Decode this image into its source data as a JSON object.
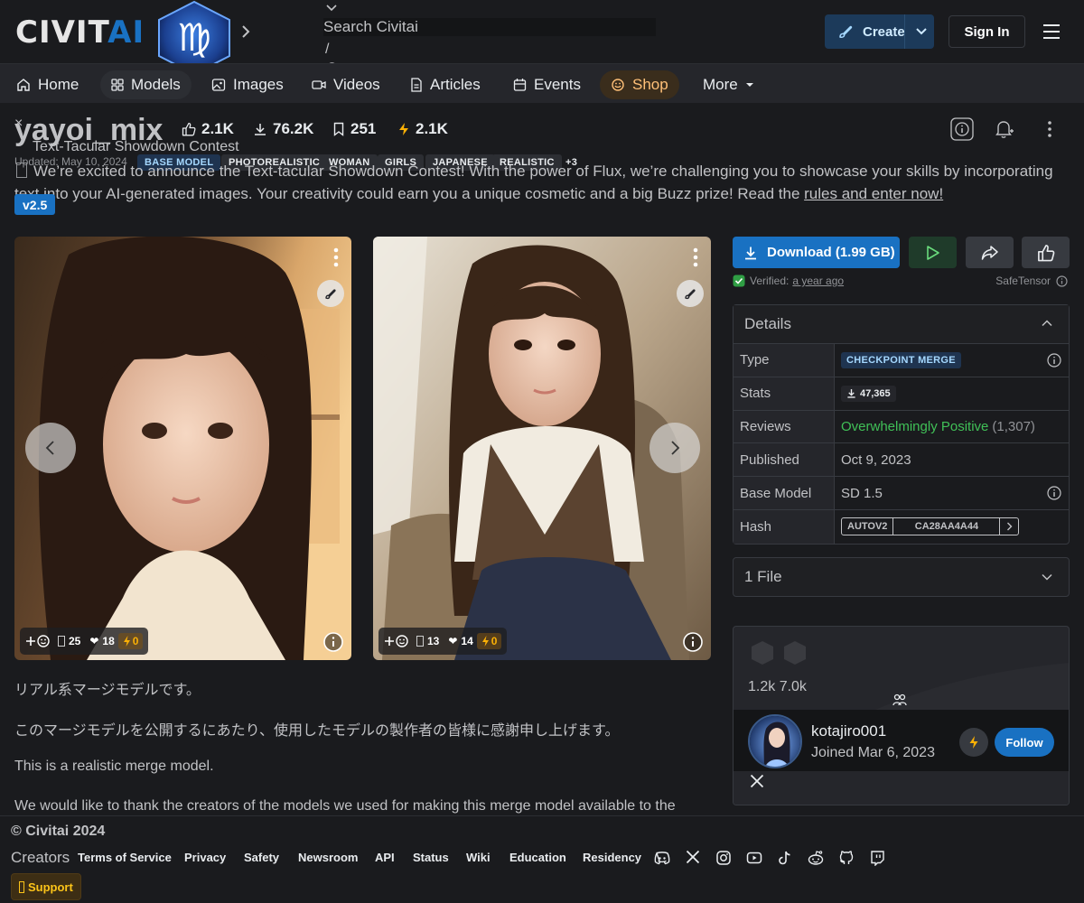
{
  "brand": {
    "logo_part1": "CIVIT",
    "logo_part2": "AI"
  },
  "search": {
    "placeholder": "Search Civitai",
    "shortcut": "/"
  },
  "header": {
    "create_label": "Create",
    "signin_label": "Sign In"
  },
  "nav": [
    {
      "label": "Home",
      "icon": "home-icon"
    },
    {
      "label": "Models",
      "icon": "models-icon"
    },
    {
      "label": "Images",
      "icon": "image-icon"
    },
    {
      "label": "Videos",
      "icon": "video-icon"
    },
    {
      "label": "Articles",
      "icon": "article-icon"
    },
    {
      "label": "Events",
      "icon": "calendar-icon"
    },
    {
      "label": "Shop",
      "icon": "shop-icon"
    },
    {
      "label": "More",
      "icon": "caret-down-icon"
    }
  ],
  "model": {
    "title": "yayoi_mix",
    "likes": "2.1K",
    "downloads": "76.2K",
    "bookmarks": "251",
    "buzz": "2.1K",
    "updated": "Updated: May 10, 2024",
    "tags": [
      "BASE MODEL",
      "PHOTOREALISTIC",
      "WOMAN",
      "GIRLS",
      "JAPANESE",
      "REALISTIC",
      "+3"
    ],
    "version": "v2.5"
  },
  "contest": {
    "close_glyph": "×",
    "title": "Text-Tacular Showdown Contest",
    "body_icon": "",
    "body": "We’re excited to announce the Text-tacular Showdown Contest! With the power of Flux, we’re challenging you to showcase your skills by incorporating text into your AI-generated images. Your creativity could earn you a unique cosmetic and a big Buzz prize! Read the ",
    "link": "rules and enter now!"
  },
  "images": [
    {
      "reaction_count": "25",
      "hearts": "18",
      "buzz": "0"
    },
    {
      "reaction_count": "13",
      "hearts": "14",
      "buzz": "0"
    }
  ],
  "description": [
    "リアル系マージモデルです。",
    "このマージモデルを公開するにあたり、使用したモデルの製作者の皆様に感謝申し上げます。",
    "This is a realistic merge model.",
    "We would like to thank the creators of the models we used for making this merge model available to the"
  ],
  "download": {
    "label": "Download (1.99 GB)",
    "verified_label": "Verified:",
    "verified_time": "a year ago",
    "format": "SafeTensor"
  },
  "details": {
    "heading": "Details",
    "rows": [
      {
        "key": "Type",
        "value": "CHECKPOINT MERGE"
      },
      {
        "key": "Stats",
        "value": "47,365"
      },
      {
        "key": "Reviews",
        "value": "Overwhelmingly Positive",
        "extra": "(1,307)"
      },
      {
        "key": "Published",
        "value": "Oct 9, 2023"
      },
      {
        "key": "Base Model",
        "value": "SD 1.5"
      },
      {
        "key": "Hash",
        "value": "AUTOV2",
        "extra": "CA28AA4A44"
      }
    ]
  },
  "files": {
    "label": "1 File"
  },
  "creator": {
    "counts": "1.2k 7.0k",
    "username": "kotajiro001",
    "joined": "Joined Mar 6, 2023",
    "follow_label": "Follow"
  },
  "footer": {
    "copyright": "© Civitai 2024",
    "creators": "Creators",
    "links": [
      "Terms of Service",
      "Privacy",
      "Safety",
      "Newsroom",
      "API",
      "Status",
      "Wiki",
      "Education",
      "Residency"
    ],
    "support_icon": "",
    "support": "Support"
  },
  "colors": {
    "accent": "#1971c2",
    "background": "#1a1b1e",
    "positive": "#40c057",
    "buzz": "#fab005"
  }
}
